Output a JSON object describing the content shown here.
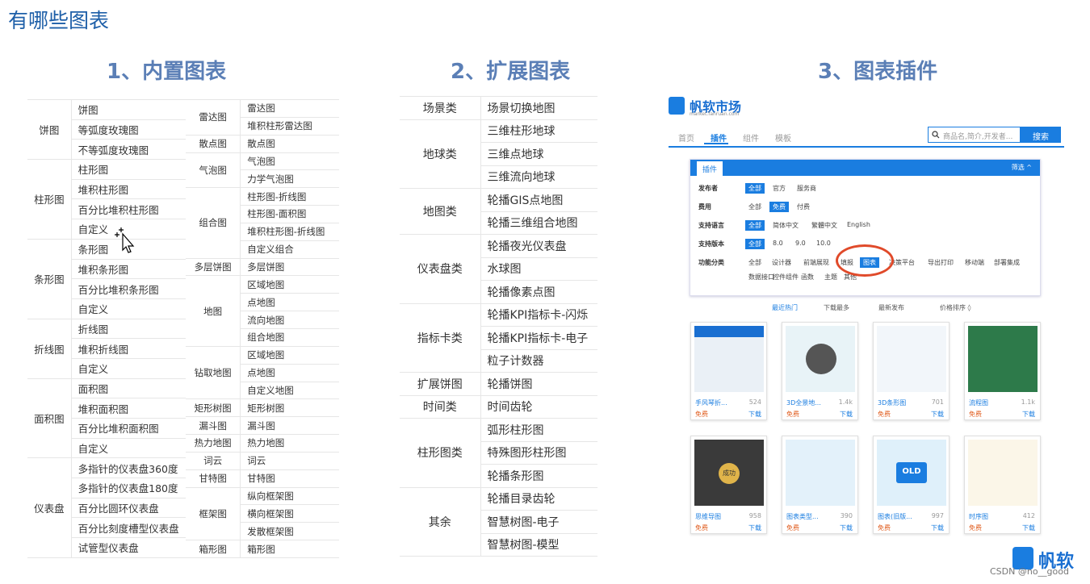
{
  "page_title": "有哪些图表",
  "sections": {
    "s1": "1、内置图表",
    "s2": "2、扩展图表",
    "s3": "3、图表插件"
  },
  "builtin_left": [
    {
      "cat": "饼图",
      "items": [
        "饼图",
        "等弧度玫瑰图",
        "不等弧度玫瑰图"
      ]
    },
    {
      "cat": "柱形图",
      "items": [
        "柱形图",
        "堆积柱形图",
        "百分比堆积柱形图",
        "自定义"
      ]
    },
    {
      "cat": "条形图",
      "items": [
        "条形图",
        "堆积条形图",
        "百分比堆积条形图",
        "自定义"
      ]
    },
    {
      "cat": "折线图",
      "items": [
        "折线图",
        "堆积折线图",
        "自定义"
      ]
    },
    {
      "cat": "面积图",
      "items": [
        "面积图",
        "堆积面积图",
        "百分比堆积面积图",
        "自定义"
      ]
    },
    {
      "cat": "仪表盘",
      "items": [
        "多指针的仪表盘360度",
        "多指针的仪表盘180度",
        "百分比圆环仪表盘",
        "百分比刻度槽型仪表盘",
        "试管型仪表盘"
      ]
    }
  ],
  "builtin_right": [
    {
      "cat": "雷达图",
      "items": [
        "雷达图",
        "堆积柱形雷达图"
      ]
    },
    {
      "cat": "散点图",
      "items": [
        "散点图"
      ]
    },
    {
      "cat": "气泡图",
      "items": [
        "气泡图",
        "力学气泡图"
      ]
    },
    {
      "cat": "组合图",
      "items": [
        "柱形图-折线图",
        "柱形图-面积图",
        "堆积柱形图-折线图",
        "自定义组合"
      ]
    },
    {
      "cat": "多层饼图",
      "items": [
        "多层饼图"
      ]
    },
    {
      "cat": "地图",
      "items": [
        "区域地图",
        "点地图",
        "流向地图",
        "组合地图"
      ]
    },
    {
      "cat": "钻取地图",
      "items": [
        "区域地图",
        "点地图",
        "自定义地图"
      ]
    },
    {
      "cat": "矩形树图",
      "items": [
        "矩形树图"
      ]
    },
    {
      "cat": "漏斗图",
      "items": [
        "漏斗图"
      ]
    },
    {
      "cat": "热力地图",
      "items": [
        "热力地图"
      ]
    },
    {
      "cat": "词云",
      "items": [
        "词云"
      ]
    },
    {
      "cat": "甘特图",
      "items": [
        "甘特图"
      ]
    },
    {
      "cat": "框架图",
      "items": [
        "纵向框架图",
        "横向框架图",
        "发散框架图"
      ]
    },
    {
      "cat": "箱形图",
      "items": [
        "箱形图"
      ]
    }
  ],
  "extended": [
    {
      "cat": "场景类",
      "items": [
        "场景切换地图"
      ]
    },
    {
      "cat": "地球类",
      "items": [
        "三维柱形地球",
        "三维点地球",
        "三维流向地球"
      ]
    },
    {
      "cat": "地图类",
      "items": [
        "轮播GIS点地图",
        "轮播三维组合地图"
      ]
    },
    {
      "cat": "仪表盘类",
      "items": [
        "轮播夜光仪表盘",
        "水球图",
        "轮播像素点图"
      ]
    },
    {
      "cat": "指标卡类",
      "items": [
        "轮播KPI指标卡-闪烁",
        "轮播KPI指标卡-电子",
        "粒子计数器"
      ]
    },
    {
      "cat": "扩展饼图",
      "items": [
        "轮播饼图"
      ]
    },
    {
      "cat": "时间类",
      "items": [
        "时间齿轮"
      ]
    },
    {
      "cat": "柱形图类",
      "items": [
        "弧形柱形图",
        "特殊图形柱形图",
        "轮播条形图"
      ]
    },
    {
      "cat": "其余",
      "items": [
        "轮播目录齿轮",
        "智慧树图-电子",
        "智慧树图-模型"
      ]
    }
  ],
  "market": {
    "logo": "帆软市场",
    "logo_sub": "market.fanruan.com",
    "nav": [
      "首页",
      "插件",
      "组件",
      "模板"
    ],
    "search_placeholder": "商品名,简介,开发者...",
    "search_btn": "搜索",
    "filter_tab": "插件",
    "filter_more": "筛选 ^",
    "filters": [
      {
        "label": "发布者",
        "opts": [
          "全部",
          "官方",
          "服务商"
        ],
        "on": 0
      },
      {
        "label": "费用",
        "opts": [
          "全部",
          "免费",
          "付费"
        ],
        "on": 1
      },
      {
        "label": "支持语言",
        "opts": [
          "全部",
          "简体中文",
          "繁體中文",
          "English"
        ],
        "on": 0
      },
      {
        "label": "支持版本",
        "opts": [
          "全部",
          "8.0",
          "9.0",
          "10.0"
        ],
        "on": 0
      },
      {
        "label": "功能分类",
        "opts": [
          "全部",
          "设计器",
          "前端展现",
          "填报",
          "图表",
          "决策平台",
          "导出打印",
          "移动端",
          "部署集成"
        ],
        "on": 4
      },
      {
        "label": "",
        "opts": [
          "数据接口",
          "控件组件",
          "函数",
          "主题",
          "其他"
        ],
        "on": -1
      }
    ],
    "sort": [
      "最近热门",
      "下载最多",
      "最新发布",
      "价格排序 ◊"
    ],
    "cards": [
      {
        "name": "手风琴折...",
        "count": "524",
        "free": "免费",
        "dl": "下载",
        "color": "#eaf0f6"
      },
      {
        "name": "3D全景地...",
        "count": "1.4k",
        "free": "免费",
        "dl": "下载",
        "color": "#e8f3f7"
      },
      {
        "name": "3D条形图",
        "count": "701",
        "free": "免费",
        "dl": "下载",
        "color": "#f2f6fa"
      },
      {
        "name": "流程图",
        "count": "1.1k",
        "free": "免费",
        "dl": "下载",
        "color": "#2d7a4a"
      },
      {
        "name": "思维导图",
        "count": "958",
        "free": "免费",
        "dl": "下载",
        "color": "#3a3a3a"
      },
      {
        "name": "图表类型...",
        "count": "390",
        "free": "免费",
        "dl": "下载",
        "color": "#e3f1fa"
      },
      {
        "name": "图表(旧版...",
        "count": "997",
        "free": "免费",
        "dl": "下载",
        "color": "#dff0fa"
      },
      {
        "name": "时序图",
        "count": "412",
        "free": "免费",
        "dl": "下载",
        "color": "#fbf6e8"
      }
    ],
    "old_label": "OLD",
    "mind_center": "成功"
  },
  "watermark": "CSDN @no__good",
  "brand": "帆软",
  "colors": {
    "accent": "#1a7de0",
    "highlight_circle": "#e04a2a",
    "title": "#1e5fa8"
  }
}
